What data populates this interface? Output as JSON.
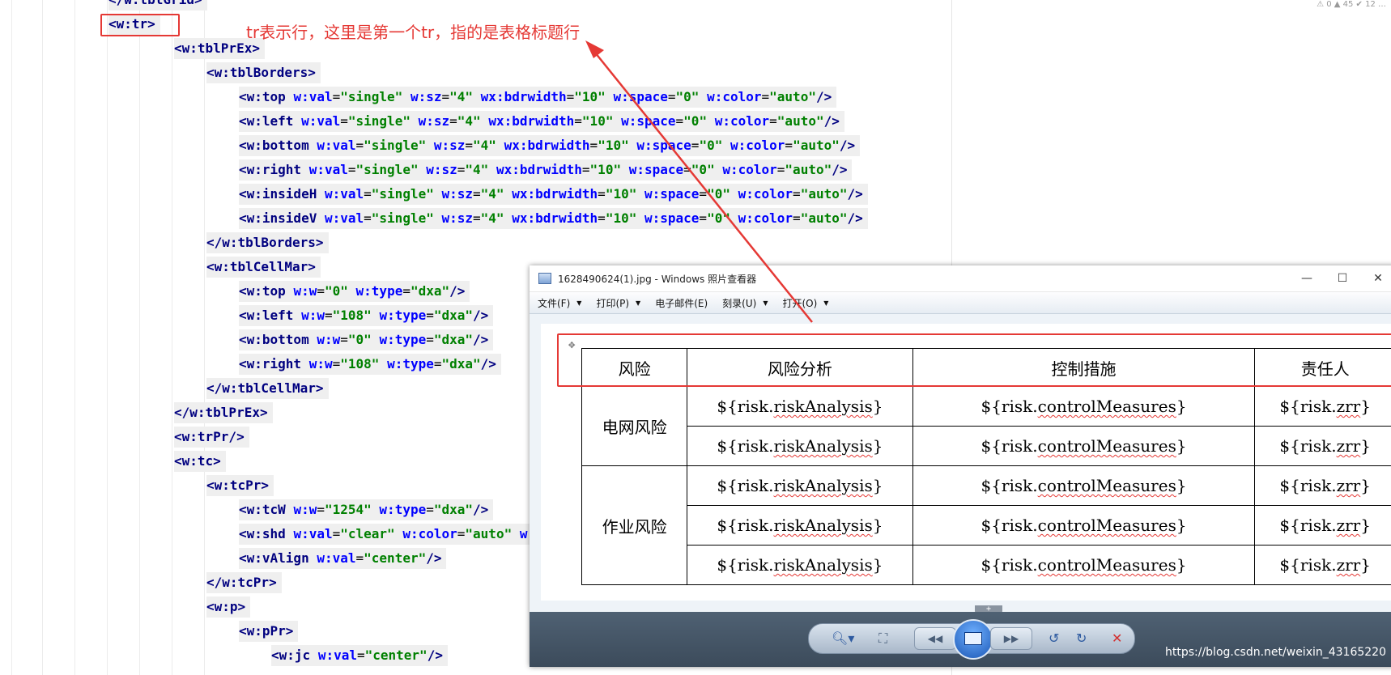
{
  "editor": {
    "top_fragment": "</w:tblGrid>",
    "status_text": "⚠ 0  ▲ 45  ✔ 12 …",
    "lines": [
      {
        "tag": "<w:tr>",
        "attrs": []
      },
      {
        "tag": "<w:tblPrEx>",
        "attrs": []
      },
      {
        "tag": "<w:tblBorders>",
        "attrs": []
      },
      {
        "tag": "<w:top",
        "attrs": [
          [
            "w:val",
            "\"single\""
          ],
          [
            "w:sz",
            "\"4\""
          ],
          [
            "wx:bdrwidth",
            "\"10\""
          ],
          [
            "w:space",
            "\"0\""
          ],
          [
            "w:color",
            "\"auto\""
          ]
        ],
        "end": "/>"
      },
      {
        "tag": "<w:left",
        "attrs": [
          [
            "w:val",
            "\"single\""
          ],
          [
            "w:sz",
            "\"4\""
          ],
          [
            "wx:bdrwidth",
            "\"10\""
          ],
          [
            "w:space",
            "\"0\""
          ],
          [
            "w:color",
            "\"auto\""
          ]
        ],
        "end": "/>"
      },
      {
        "tag": "<w:bottom",
        "attrs": [
          [
            "w:val",
            "\"single\""
          ],
          [
            "w:sz",
            "\"4\""
          ],
          [
            "wx:bdrwidth",
            "\"10\""
          ],
          [
            "w:space",
            "\"0\""
          ],
          [
            "w:color",
            "\"auto\""
          ]
        ],
        "end": "/>"
      },
      {
        "tag": "<w:right",
        "attrs": [
          [
            "w:val",
            "\"single\""
          ],
          [
            "w:sz",
            "\"4\""
          ],
          [
            "wx:bdrwidth",
            "\"10\""
          ],
          [
            "w:space",
            "\"0\""
          ],
          [
            "w:color",
            "\"auto\""
          ]
        ],
        "end": "/>"
      },
      {
        "tag": "<w:insideH",
        "attrs": [
          [
            "w:val",
            "\"single\""
          ],
          [
            "w:sz",
            "\"4\""
          ],
          [
            "wx:bdrwidth",
            "\"10\""
          ],
          [
            "w:space",
            "\"0\""
          ],
          [
            "w:color",
            "\"auto\""
          ]
        ],
        "end": "/>"
      },
      {
        "tag": "<w:insideV",
        "attrs": [
          [
            "w:val",
            "\"single\""
          ],
          [
            "w:sz",
            "\"4\""
          ],
          [
            "wx:bdrwidth",
            "\"10\""
          ],
          [
            "w:space",
            "\"0\""
          ],
          [
            "w:color",
            "\"auto\""
          ]
        ],
        "end": "/>"
      },
      {
        "tag": "</w:tblBorders>",
        "attrs": []
      },
      {
        "tag": "<w:tblCellMar>",
        "attrs": []
      },
      {
        "tag": "<w:top",
        "attrs": [
          [
            "w:w",
            "\"0\""
          ],
          [
            "w:type",
            "\"dxa\""
          ]
        ],
        "end": "/>"
      },
      {
        "tag": "<w:left",
        "attrs": [
          [
            "w:w",
            "\"108\""
          ],
          [
            "w:type",
            "\"dxa\""
          ]
        ],
        "end": "/>"
      },
      {
        "tag": "<w:bottom",
        "attrs": [
          [
            "w:w",
            "\"0\""
          ],
          [
            "w:type",
            "\"dxa\""
          ]
        ],
        "end": "/>"
      },
      {
        "tag": "<w:right",
        "attrs": [
          [
            "w:w",
            "\"108\""
          ],
          [
            "w:type",
            "\"dxa\""
          ]
        ],
        "end": "/>"
      },
      {
        "tag": "</w:tblCellMar>",
        "attrs": []
      },
      {
        "tag": "</w:tblPrEx>",
        "attrs": []
      },
      {
        "tag": "<w:trPr/>",
        "attrs": []
      },
      {
        "tag": "<w:tc>",
        "attrs": []
      },
      {
        "tag": "<w:tcPr>",
        "attrs": []
      },
      {
        "tag": "<w:tcW",
        "attrs": [
          [
            "w:w",
            "\"1254\""
          ],
          [
            "w:type",
            "\"dxa\""
          ]
        ],
        "end": "/>"
      },
      {
        "tag": "<w:shd",
        "attrs": [
          [
            "w:val",
            "\"clear\""
          ],
          [
            "w:color",
            "\"auto\""
          ],
          [
            "w:fi",
            ""
          ]
        ],
        "end": ""
      },
      {
        "tag": "<w:vAlign",
        "attrs": [
          [
            "w:val",
            "\"center\""
          ]
        ],
        "end": "/>"
      },
      {
        "tag": "</w:tcPr>",
        "attrs": []
      },
      {
        "tag": "<w:p>",
        "attrs": []
      },
      {
        "tag": "<w:pPr>",
        "attrs": []
      },
      {
        "tag": "<w:jc",
        "attrs": [
          [
            "w:val",
            "\"center\""
          ]
        ],
        "end": "/>"
      }
    ]
  },
  "annotation": {
    "text": "tr表示行，这里是第一个tr，指的是表格标题行",
    "color": "#e53935"
  },
  "viewer": {
    "title": "1628490624(1).jpg - Windows 照片查看器",
    "window_buttons": [
      "—",
      "☐",
      "✕"
    ],
    "menu": [
      {
        "label": "文件(F)"
      },
      {
        "label": "打印(P)"
      },
      {
        "label": "电子邮件(E)"
      },
      {
        "label": "刻录(U)"
      },
      {
        "label": "打开(O)"
      }
    ],
    "table": {
      "headers": [
        "风险",
        "风险分析",
        "控制措施",
        "责任人"
      ],
      "groups": [
        {
          "name": "电网风险",
          "rows": 2
        },
        {
          "name": "作业风险",
          "rows": 3
        }
      ],
      "cell_prefix": "${risk.",
      "cell_suffix": "}",
      "fields": [
        "riskAnalysis",
        "controlMeasures",
        "zrr"
      ]
    },
    "add_row_label": "+",
    "watermark": "https://blog.csdn.net/weixin_43165220"
  }
}
